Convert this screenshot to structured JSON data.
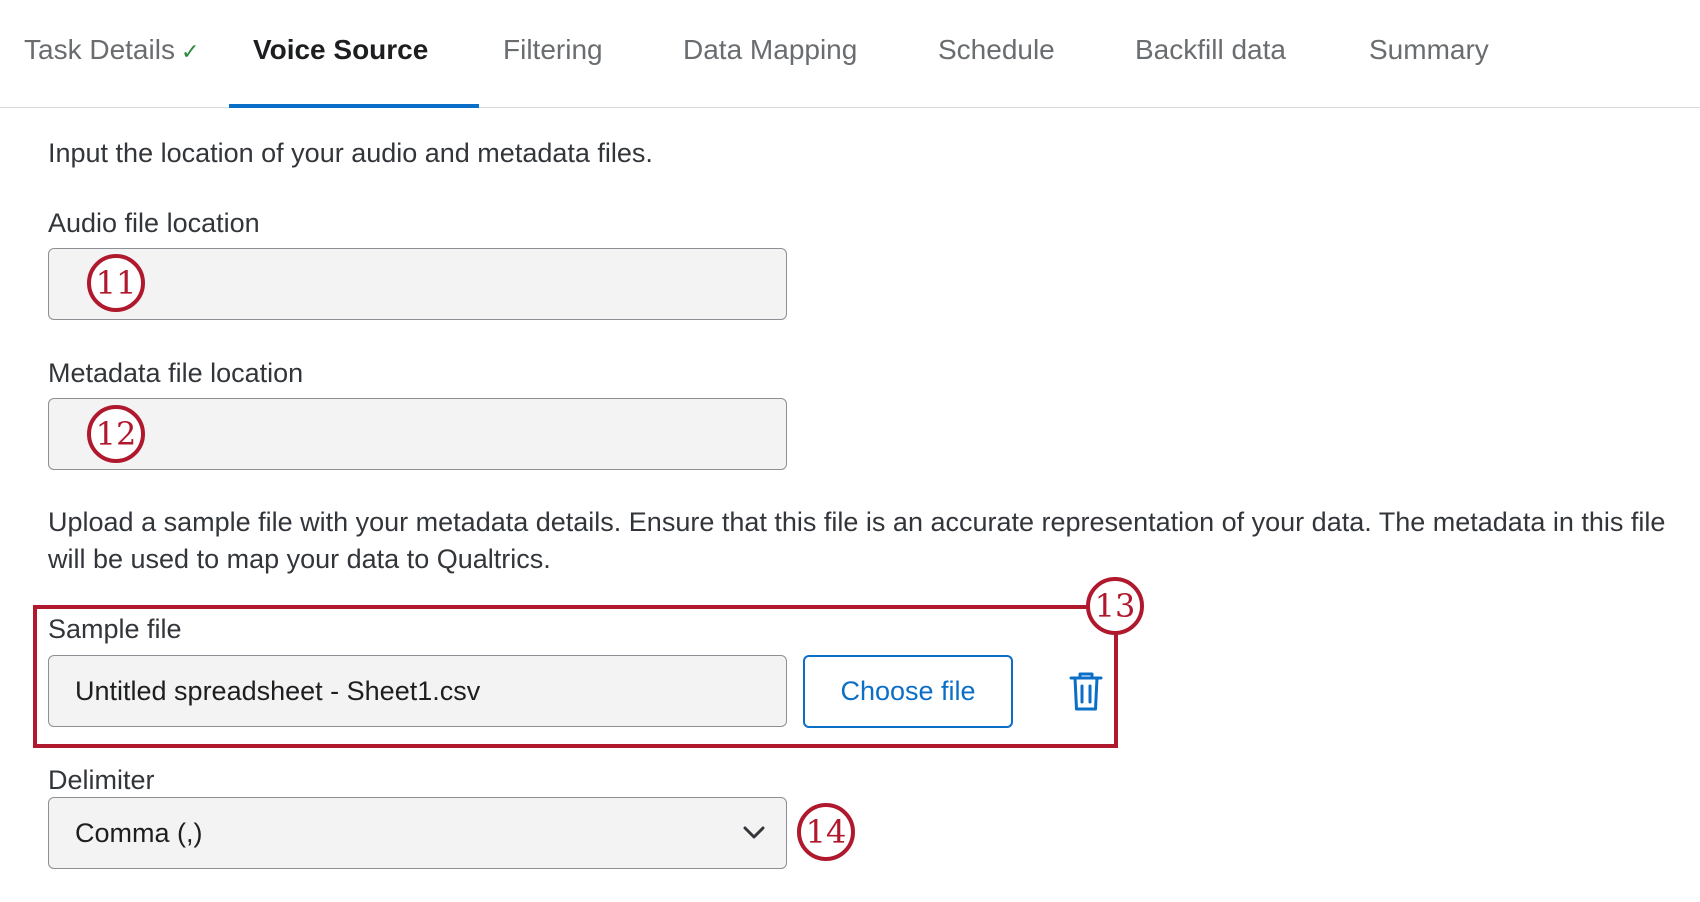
{
  "tabs": [
    {
      "label": "Task Details",
      "completed": true
    },
    {
      "label": "Voice Source",
      "active": true
    },
    {
      "label": "Filtering"
    },
    {
      "label": "Data Mapping"
    },
    {
      "label": "Schedule"
    },
    {
      "label": "Backfill data"
    },
    {
      "label": "Summary"
    }
  ],
  "intro_text": "Input the location of your audio and metadata files.",
  "audio": {
    "label": "Audio file location",
    "value": "",
    "marker": "11"
  },
  "metadata": {
    "label": "Metadata file location",
    "value": "",
    "marker": "12"
  },
  "upload_text": "Upload a sample file with your metadata details. Ensure that this file is an accurate representation of your data. The metadata in this file will be used to map your data to Qualtrics.",
  "sample": {
    "label": "Sample file",
    "value": "Untitled spreadsheet - Sheet1.csv",
    "choose_label": "Choose file",
    "marker": "13"
  },
  "delimiter": {
    "label": "Delimiter",
    "value": "Comma (,)",
    "marker": "14"
  },
  "colors": {
    "accent": "#0b6ec7",
    "annotation": "#b0182d",
    "success": "#2e8b3d"
  },
  "icons": {
    "check": "check-icon",
    "trash": "trash-icon",
    "dropdown": "chevron-down-icon"
  }
}
